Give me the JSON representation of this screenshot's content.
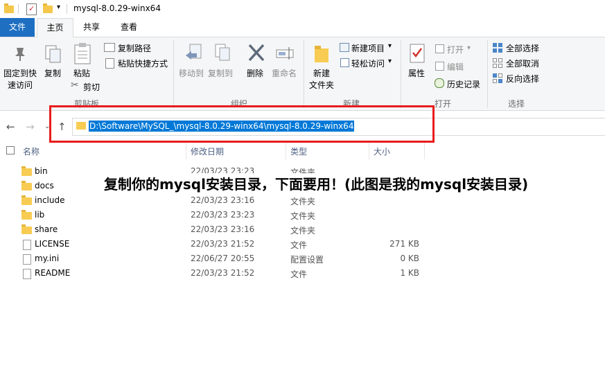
{
  "window": {
    "title": "mysql-8.0.29-winx64"
  },
  "tabs": {
    "file": "文件",
    "home": "主页",
    "share": "共享",
    "view": "查看"
  },
  "ribbon": {
    "clipboard": {
      "pin": "固定到快",
      "pin2": "速访问",
      "copy": "复制",
      "paste": "粘贴",
      "copy_path": "复制路径",
      "paste_shortcut": "粘贴快捷方式",
      "cut": "剪切",
      "group": "剪贴板"
    },
    "organize": {
      "move_to": "移动到",
      "copy_to": "复制到",
      "delete": "删除",
      "rename": "重命名",
      "group": "组织"
    },
    "new": {
      "new_folder": "新建",
      "new_folder2": "文件夹",
      "new_item": "新建项目",
      "easy_access": "轻松访问",
      "group": "新建"
    },
    "open": {
      "properties": "属性",
      "open": "打开",
      "edit": "编辑",
      "history": "历史记录",
      "group": "打开"
    },
    "select": {
      "select_all": "全部选择",
      "select_none": "全部取消",
      "invert": "反向选择",
      "group": "选择"
    }
  },
  "address": {
    "path": "D:\\Software\\MySQL_\\mysql-8.0.29-winx64\\mysql-8.0.29-winx64"
  },
  "columns": {
    "name": "名称",
    "date": "修改日期",
    "type": "类型",
    "size": "大小"
  },
  "files": [
    {
      "name": "bin",
      "date": "22/03/23 23:23",
      "type": "文件夹",
      "size": "",
      "kind": "folder"
    },
    {
      "name": "docs",
      "date": "22/03/23 23:16",
      "type": "文件夹",
      "size": "",
      "kind": "folder"
    },
    {
      "name": "include",
      "date": "22/03/23 23:16",
      "type": "文件夹",
      "size": "",
      "kind": "folder"
    },
    {
      "name": "lib",
      "date": "22/03/23 23:23",
      "type": "文件夹",
      "size": "",
      "kind": "folder"
    },
    {
      "name": "share",
      "date": "22/03/23 23:16",
      "type": "文件夹",
      "size": "",
      "kind": "folder"
    },
    {
      "name": "LICENSE",
      "date": "22/03/23 21:52",
      "type": "文件",
      "size": "271 KB",
      "kind": "file"
    },
    {
      "name": "my.ini",
      "date": "22/06/27 20:55",
      "type": "配置设置",
      "size": "0 KB",
      "kind": "ini"
    },
    {
      "name": "README",
      "date": "22/03/23 21:52",
      "type": "文件",
      "size": "1 KB",
      "kind": "file"
    }
  ],
  "annotation": "复制你的mysql安装目录，下面要用！(此图是我的mysql安装目录)",
  "colors": {
    "accent": "#1e6fc1",
    "highlight": "#e81c1c",
    "selection": "#0078d7"
  }
}
